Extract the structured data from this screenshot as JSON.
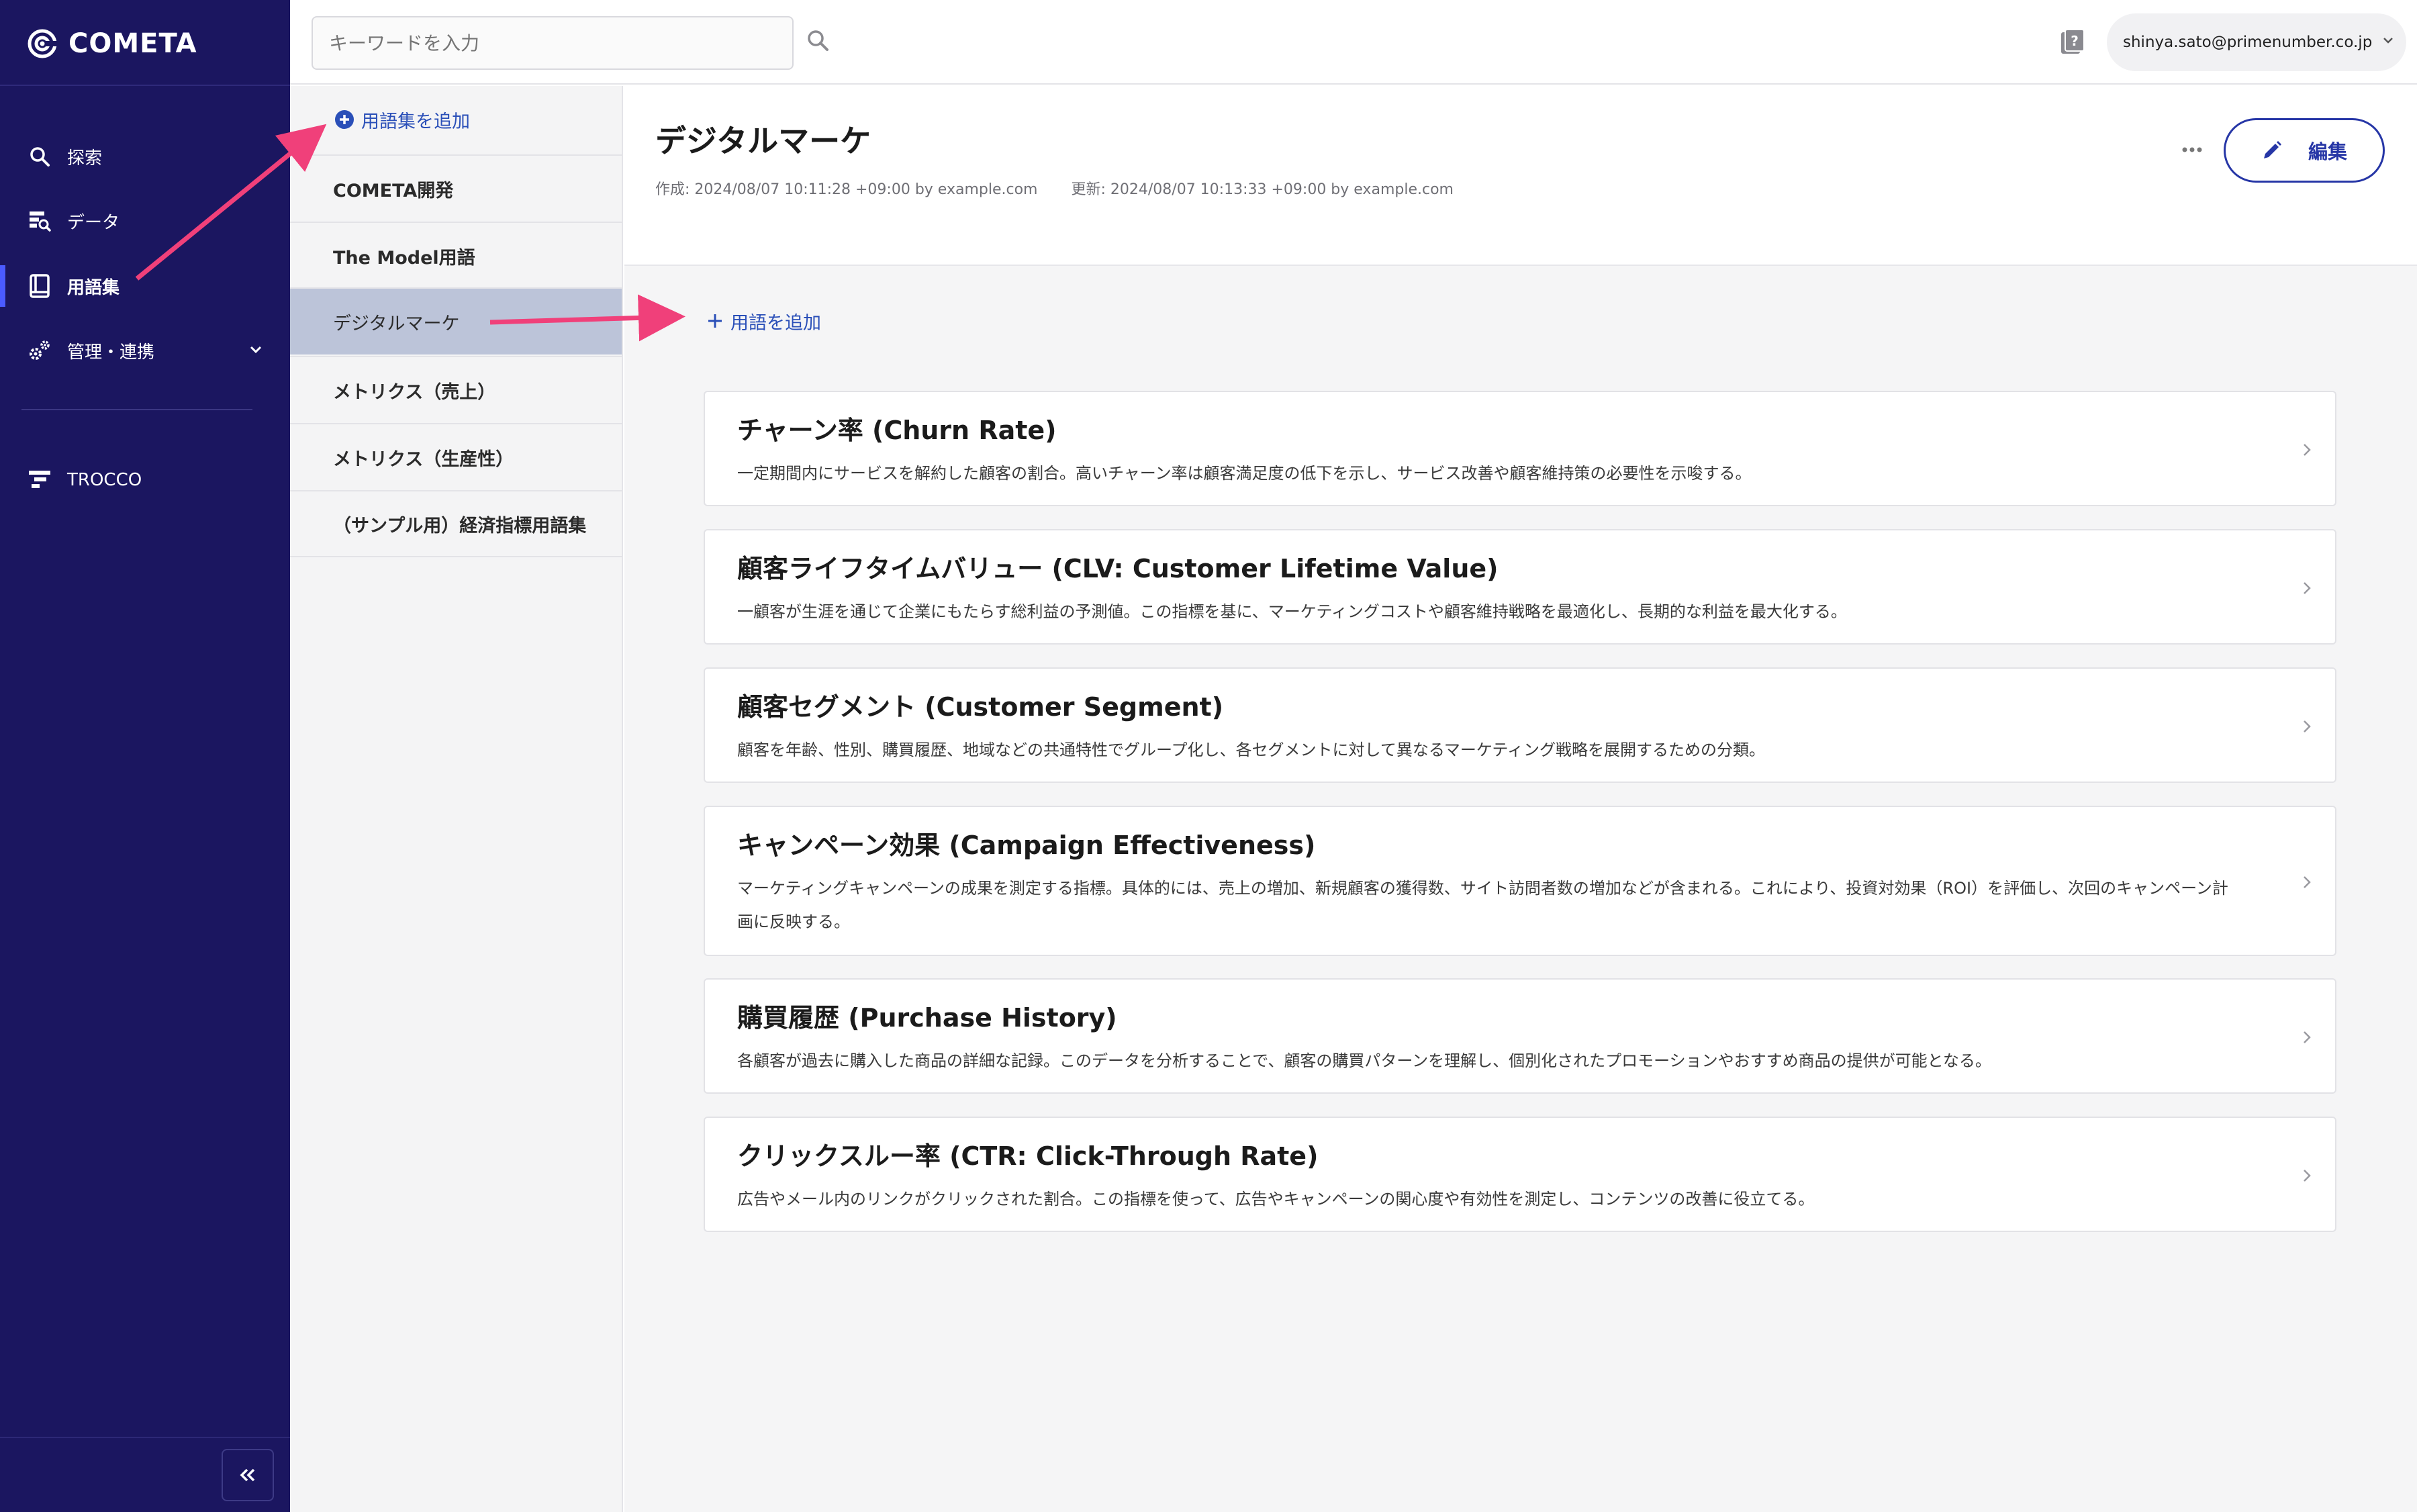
{
  "app": {
    "name": "COMETA"
  },
  "sidebar": {
    "items": [
      {
        "label": "探索",
        "icon": "search-icon"
      },
      {
        "label": "データ",
        "icon": "data-search-icon"
      },
      {
        "label": "用語集",
        "icon": "book-icon",
        "active": true
      },
      {
        "label": "管理・連携",
        "icon": "gears-icon",
        "expandable": true
      }
    ],
    "external": {
      "label": "TROCCO",
      "icon": "trocco-logo-icon"
    },
    "collapse_icon": "double-chevron-left-icon"
  },
  "topbar": {
    "search_placeholder": "キーワードを入力",
    "user_email": "shinya.sato@primenumber.co.jp"
  },
  "glossary_list": {
    "add_label": "用語集を追加",
    "items": [
      {
        "label": "COMETA開発"
      },
      {
        "label": "The Model用語"
      },
      {
        "label": "デジタルマーケ",
        "selected": true
      },
      {
        "label": "メトリクス（売上）"
      },
      {
        "label": "メトリクス（生産性）"
      },
      {
        "label": "（サンプル用）経済指標用語集"
      }
    ]
  },
  "main": {
    "title": "デジタルマーケ",
    "created": "作成: 2024/08/07 10:11:28 +09:00 by example.com",
    "updated": "更新: 2024/08/07 10:13:33 +09:00 by example.com",
    "edit_label": "編集",
    "add_term_label": "用語を追加",
    "terms": [
      {
        "title": "チャーン率 (Churn Rate)",
        "description": "一定期間内にサービスを解約した顧客の割合。高いチャーン率は顧客満足度の低下を示し、サービス改善や顧客維持策の必要性を示唆する。"
      },
      {
        "title": "顧客ライフタイムバリュー (CLV: Customer Lifetime Value)",
        "description": "一顧客が生涯を通じて企業にもたらす総利益の予測値。この指標を基に、マーケティングコストや顧客維持戦略を最適化し、長期的な利益を最大化する。"
      },
      {
        "title": "顧客セグメント (Customer Segment)",
        "description": "顧客を年齢、性別、購買履歴、地域などの共通特性でグループ化し、各セグメントに対して異なるマーケティング戦略を展開するための分類。"
      },
      {
        "title": "キャンペーン効果 (Campaign Effectiveness)",
        "description": "マーケティングキャンペーンの成果を測定する指標。具体的には、売上の増加、新規顧客の獲得数、サイト訪問者数の増加などが含まれる。これにより、投資対効果（ROI）を評価し、次回のキャンペーン計画に反映する。"
      },
      {
        "title": "購買履歴 (Purchase History)",
        "description": "各顧客が過去に購入した商品の詳細な記録。このデータを分析することで、顧客の購買パターンを理解し、個別化されたプロモーションやおすすめ商品の提供が可能となる。"
      },
      {
        "title": "クリックスルー率 (CTR: Click-Through Rate)",
        "description": "広告やメール内のリンクがクリックされた割合。この指標を使って、広告やキャンペーンの関心度や有効性を測定し、コンテンツの改善に役立てる。"
      }
    ]
  },
  "colors": {
    "sidebar_bg": "#1b1660",
    "accent": "#2a4fb8",
    "edit_button": "#2636a6",
    "selected_row": "#bcc4d9",
    "annotation_arrow": "#f0407a"
  }
}
